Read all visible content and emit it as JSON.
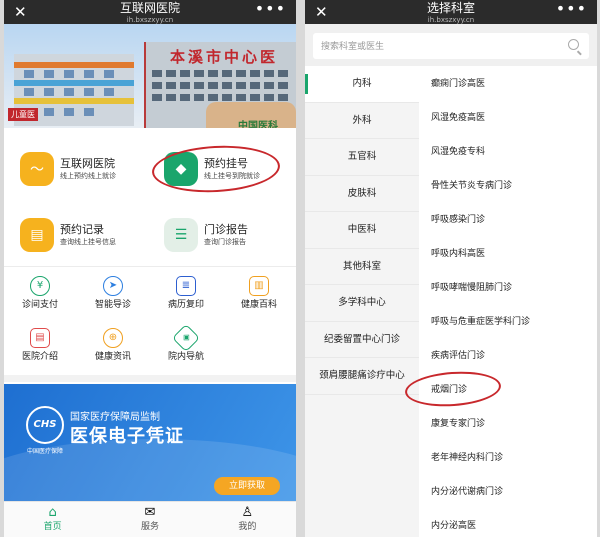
{
  "left": {
    "title": "互联网医院",
    "url": "ih.bxszxyy.cn",
    "banner": {
      "sign": "本溪市中心医",
      "logo_text": "中国医科",
      "flag_text": "儿童医"
    },
    "features": [
      {
        "title": "互联网医院",
        "sub": "线上预约线上就诊",
        "icon": "chart-icon"
      },
      {
        "title": "预约挂号",
        "sub": "线上挂号到院就诊",
        "icon": "diamond-icon"
      },
      {
        "title": "预约记录",
        "sub": "查询线上挂号信息",
        "icon": "clipboard-icon"
      },
      {
        "title": "门诊报告",
        "sub": "查询门诊报告",
        "icon": "report-icon"
      }
    ],
    "services": [
      {
        "label": "诊间支付",
        "glyph": "¥"
      },
      {
        "label": "智能导诊",
        "glyph": "➤"
      },
      {
        "label": "病历复印",
        "glyph": "≣"
      },
      {
        "label": "健康百科",
        "glyph": "▥"
      },
      {
        "label": "医院介绍",
        "glyph": "▤"
      },
      {
        "label": "健康资讯",
        "glyph": "⊕"
      },
      {
        "label": "院内导航",
        "glyph": "◈"
      }
    ],
    "promo": {
      "emblem": "CHS",
      "emblem_sub": "中国医疗保障",
      "line1": "国家医疗保障局监制",
      "line2": "医保电子凭证",
      "button": "立即获取"
    },
    "tabs": [
      {
        "label": "首页",
        "glyph": "⌂"
      },
      {
        "label": "服务",
        "glyph": "✉"
      },
      {
        "label": "我的",
        "glyph": "♙"
      }
    ]
  },
  "right": {
    "title": "选择科室",
    "url": "ih.bxszxyy.cn",
    "search_placeholder": "搜索科室或医生",
    "categories": [
      "内科",
      "外科",
      "五官科",
      "皮肤科",
      "中医科",
      "其他科室",
      "多学科中心",
      "纪委留置中心门诊",
      "颈肩腰腿痛诊疗中心"
    ],
    "departments": [
      "癫痫门诊高医",
      "风湿免疫高医",
      "风湿免疫专科",
      "骨性关节炎专病门诊",
      "呼吸感染门诊",
      "呼吸内科高医",
      "呼吸哮喘慢阻肺门诊",
      "呼吸与危重症医学科门诊",
      "疾病评估门诊",
      "戒烟门诊",
      "康复专家门诊",
      "老年神经内科门诊",
      "内分泌代谢病门诊",
      "内分泌高医"
    ]
  },
  "colors": {
    "accent": "#1aa56c",
    "annotation": "#c8282c",
    "promo_blue": "#1e6fd1",
    "button_orange": "#f5a623"
  }
}
